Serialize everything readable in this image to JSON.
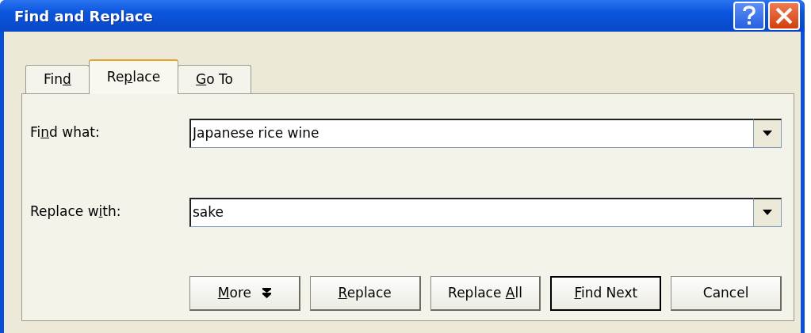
{
  "window": {
    "title": "Find and Replace"
  },
  "tabs": [
    {
      "label": [
        {
          "text": "Fin",
          "underline": false
        },
        {
          "text": "d",
          "underline": true
        }
      ],
      "selected": false
    },
    {
      "label": [
        {
          "text": "Re",
          "underline": false
        },
        {
          "text": "p",
          "underline": true
        },
        {
          "text": "lace",
          "underline": false
        }
      ],
      "selected": true
    },
    {
      "label": [
        {
          "text": "G",
          "underline": true
        },
        {
          "text": "o To",
          "underline": false
        }
      ],
      "selected": false
    }
  ],
  "fields": [
    {
      "label": [
        {
          "text": "Fi",
          "underline": false
        },
        {
          "text": "n",
          "underline": true
        },
        {
          "text": "d what:",
          "underline": false
        }
      ],
      "value": "Japanese rice wine"
    },
    {
      "label": [
        {
          "text": "Replace w",
          "underline": false
        },
        {
          "text": "i",
          "underline": true
        },
        {
          "text": "th:",
          "underline": false
        }
      ],
      "value": "sake"
    }
  ],
  "buttons": [
    {
      "label": [
        {
          "text": "M",
          "underline": true
        },
        {
          "text": "ore",
          "underline": false
        }
      ],
      "kind": "more",
      "default": false
    },
    {
      "label": [
        {
          "text": "R",
          "underline": true
        },
        {
          "text": "eplace",
          "underline": false
        }
      ],
      "kind": "plain",
      "default": false
    },
    {
      "label": [
        {
          "text": "Replace ",
          "underline": false
        },
        {
          "text": "A",
          "underline": true
        },
        {
          "text": "ll",
          "underline": false
        }
      ],
      "kind": "plain",
      "default": false
    },
    {
      "label": [
        {
          "text": "F",
          "underline": true
        },
        {
          "text": "ind Next",
          "underline": false
        }
      ],
      "kind": "plain",
      "default": true
    },
    {
      "label": [
        {
          "text": "Cancel",
          "underline": false
        }
      ],
      "kind": "plain",
      "default": false
    }
  ]
}
